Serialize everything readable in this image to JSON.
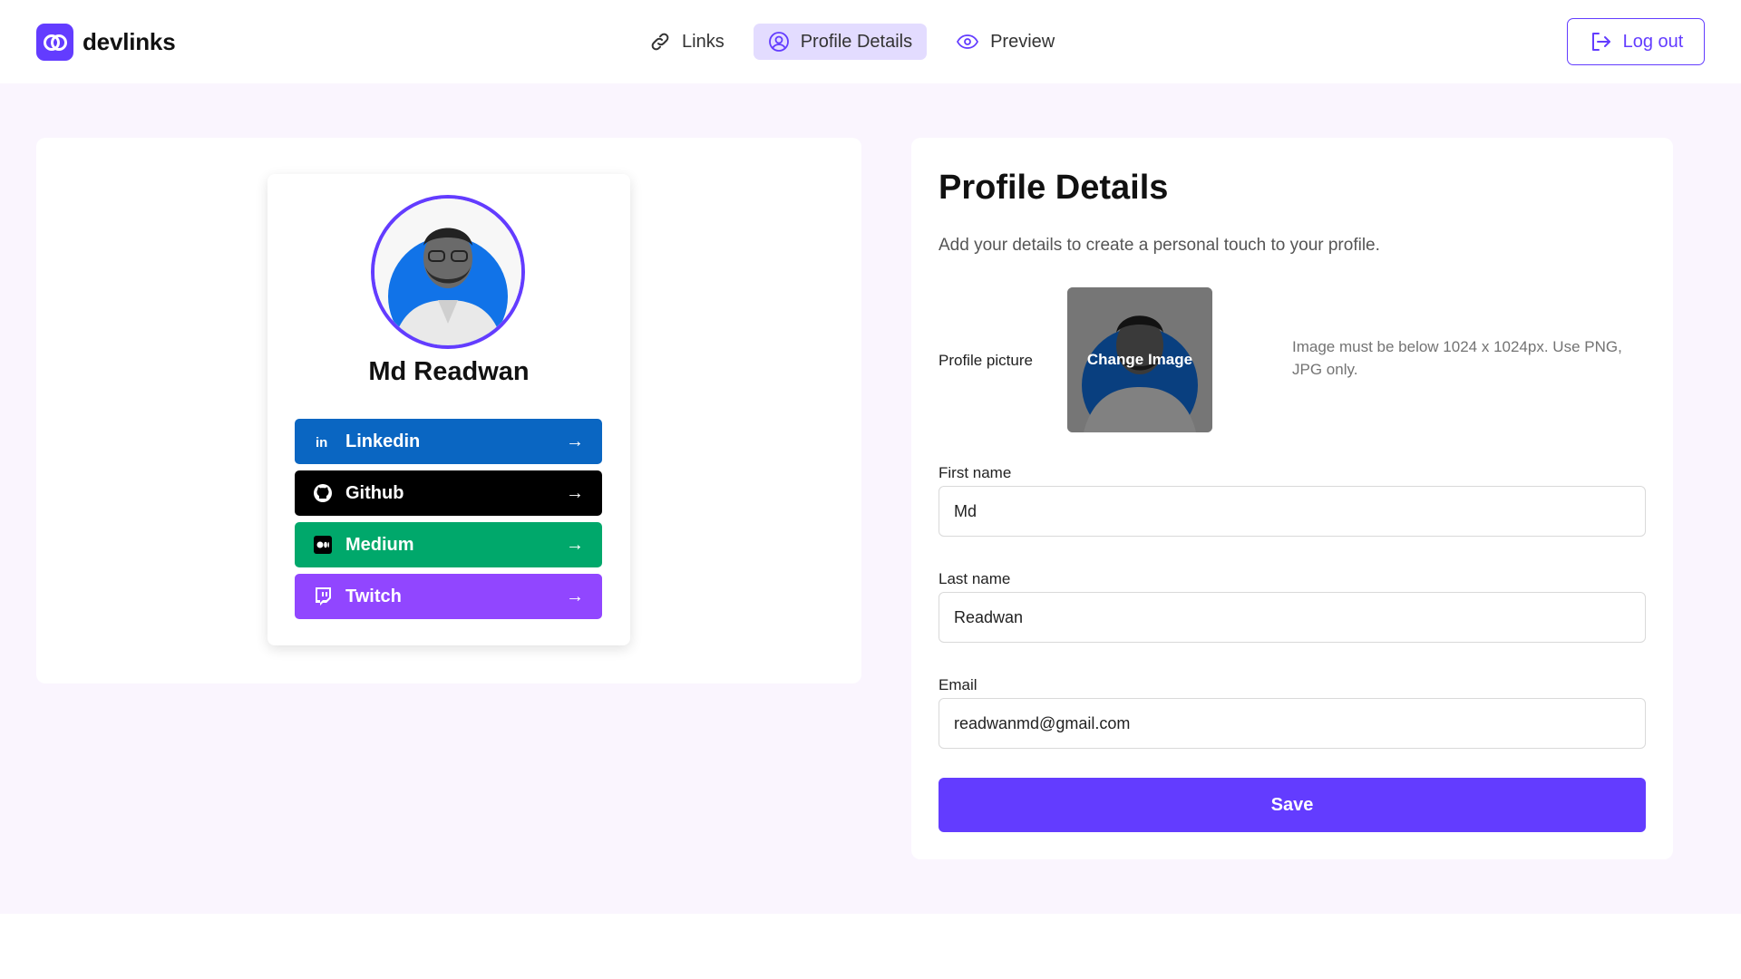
{
  "brand": {
    "name": "devlinks"
  },
  "nav": {
    "items": [
      {
        "label": "Links",
        "icon": "link-icon"
      },
      {
        "label": "Profile Details",
        "icon": "user-circle-icon",
        "active": true
      },
      {
        "label": "Preview",
        "icon": "eye-icon"
      }
    ],
    "logout_label": "Log out"
  },
  "preview": {
    "full_name": "Md Readwan",
    "links": [
      {
        "label": "Linkedin",
        "color": "#0a66c2",
        "icon": "linkedin-icon",
        "arrow": "→"
      },
      {
        "label": "Github",
        "color": "#000000",
        "icon": "github-icon",
        "arrow": "→"
      },
      {
        "label": "Medium",
        "color": "#00a86b",
        "icon": "medium-icon",
        "arrow": "→"
      },
      {
        "label": "Twitch",
        "color": "#9146ff",
        "icon": "twitch-icon",
        "arrow": "→"
      }
    ]
  },
  "form": {
    "title": "Profile Details",
    "subtitle": "Add your details to create a personal touch to your profile.",
    "picture_label": "Profile picture",
    "change_image": "Change Image",
    "picture_hint": "Image must be below 1024 x 1024px. Use PNG, JPG only.",
    "first_name_label": "First name",
    "first_name_value": "Md",
    "last_name_label": "Last name",
    "last_name_value": "Readwan",
    "email_label": "Email",
    "email_value": "readwanmd@gmail.com",
    "save_label": "Save"
  },
  "colors": {
    "accent": "#633cff",
    "accent_light": "#e3dcff",
    "page_bg": "#faf5fe"
  }
}
